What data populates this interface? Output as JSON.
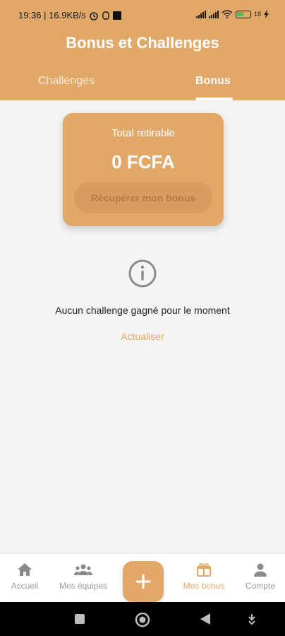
{
  "status_bar": {
    "time_network": "19:36 | 16.9KB/s",
    "battery_level": "18"
  },
  "header": {
    "title": "Bonus et Challenges",
    "tabs": [
      {
        "label": "Challenges",
        "active": false
      },
      {
        "label": "Bonus",
        "active": true
      }
    ]
  },
  "bonus_card": {
    "label": "Total retirable",
    "amount": "0 FCFA",
    "button_label": "Récupérer mon bonus"
  },
  "empty_state": {
    "icon": "info-icon",
    "message": "Aucun challenge gagné pour le moment",
    "refresh_label": "Actualiser"
  },
  "bottom_nav": {
    "items": [
      {
        "label": "Accueil",
        "icon": "home-icon",
        "active": false
      },
      {
        "label": "Mes équipes",
        "icon": "team-icon",
        "active": false
      },
      {
        "label": "Mes bonus",
        "icon": "gift-icon",
        "active": true
      },
      {
        "label": "Compte",
        "icon": "person-icon",
        "active": false
      }
    ],
    "fab_icon": "plus-icon"
  },
  "colors": {
    "accent": "#e2a868",
    "background": "#f4f4f4",
    "inactive": "#9a9a9a"
  }
}
